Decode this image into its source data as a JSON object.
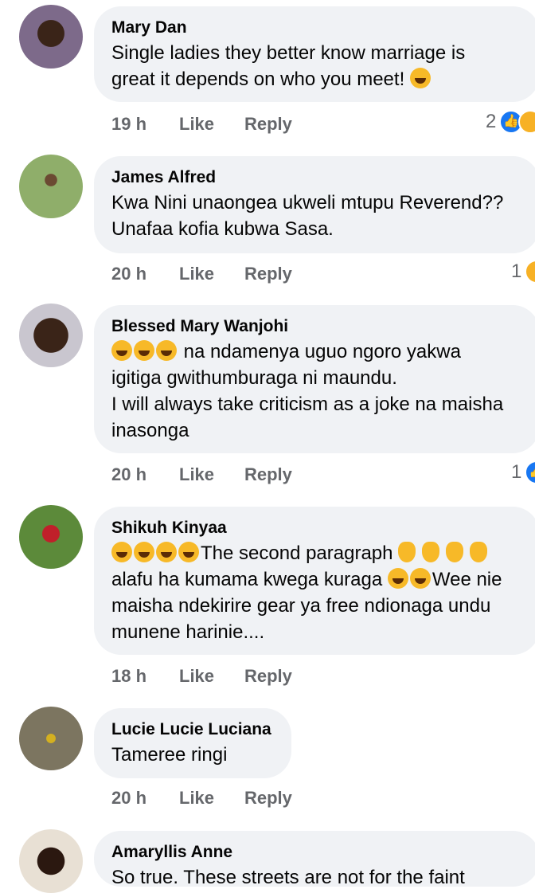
{
  "comments": [
    {
      "author": "Mary Dan",
      "line1": "Single ladies they better know marriage is",
      "line2": "great it depends on who you meet! ",
      "time": "19 h",
      "like": "Like",
      "reply": "Reply",
      "reactions": "2"
    },
    {
      "author": "James Alfred",
      "line1": "Kwa Nini unaongea ukweli mtupu Reverend??",
      "line2": "Unafaa kofia kubwa Sasa.",
      "time": "20 h",
      "like": "Like",
      "reply": "Reply",
      "reactions": "1"
    },
    {
      "author": "Blessed Mary Wanjohi",
      "line1": " na ndamenya uguo ngoro yakwa",
      "line2": "igitiga gwithumburaga ni maundu.",
      "line3": "I will always take criticism as a joke na maisha",
      "line4": "inasonga",
      "time": "20 h",
      "like": "Like",
      "reply": "Reply",
      "reactions": "1"
    },
    {
      "author": "Shikuh Kinyaa",
      "line1a": "The second paragraph ",
      "line2a": "alafu ha kumama kwega kuraga ",
      "line2b": "Wee nie",
      "line3": "maisha ndekirire gear ya free ndionaga undu",
      "line4": "munene harinie....",
      "time": "18 h",
      "like": "Like",
      "reply": "Reply"
    },
    {
      "author": "Lucie Lucie Luciana",
      "line1": "Tameree ringi",
      "time": "20 h",
      "like": "Like",
      "reply": "Reply"
    },
    {
      "author": "Amaryllis Anne",
      "line1": "So true. These streets are not for the faint"
    }
  ],
  "colors": {
    "bubble": "#f0f2f5",
    "meta": "#65676b",
    "like_blue": "#1877f2",
    "haha_yellow": "#f7b928"
  }
}
